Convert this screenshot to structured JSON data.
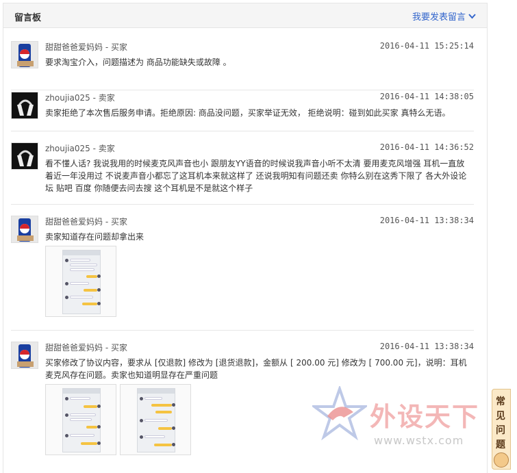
{
  "header": {
    "title": "留言板",
    "post_link": "我要发表留言"
  },
  "messages": [
    {
      "author": "甜甜爸爸爱妈妈 - 买家",
      "time": "2016-04-11 15:25:14",
      "content": "要求淘宝介入，问题描述为 商品功能缺失或故障 。",
      "avatar": "pepsi-avatar"
    },
    {
      "author": "zhoujia025 - 卖家",
      "time": "2016-04-11 14:38:05",
      "content": "卖家拒绝了本次售后服务申请。拒绝原因: 商品没问题，买家举证无效， 拒绝说明：碰到如此买家 真特么无语。",
      "avatar": "headphone-avatar"
    },
    {
      "author": "zhoujia025 - 卖家",
      "time": "2016-04-11 14:36:52",
      "content": "看不懂人话? 我说我用的时候麦克风声音也小 跟朋友YY语音的时候说我声音小听不太清 要用麦克风增强 耳机一直放着近一年没用过 不说麦声音小都忘了这耳机本来就这样了 还说我明知有问题还卖 你特么别在这秀下限了 各大外设论坛 贴吧 百度 你随便去问去搜 这个耳机是不是就这个样子",
      "avatar": "headphone-avatar"
    },
    {
      "author": "甜甜爸爸爱妈妈 - 买家",
      "time": "2016-04-11 13:38:34",
      "content": "卖家知道存在问题却拿出来",
      "avatar": "pepsi-avatar"
    },
    {
      "author": "甜甜爸爸爱妈妈 - 买家",
      "time": "2016-04-11 13:38:34",
      "content": "买家修改了协议内容，要求从 [仅退款] 修改为 [退货退款]，金额从 [ 200.00 元] 修改为 [ 700.00 元]，说明：耳机麦克风存在问题。卖家也知道明显存在严重问题",
      "avatar": "pepsi-avatar"
    }
  ],
  "watermark": {
    "text": "外设天下",
    "url": "www.wstx.com"
  },
  "faq": {
    "label": "常见问题"
  },
  "colors": {
    "link": "#3366cc",
    "header_bg": "#f5f5f5",
    "separator": "#e6e6e6"
  }
}
